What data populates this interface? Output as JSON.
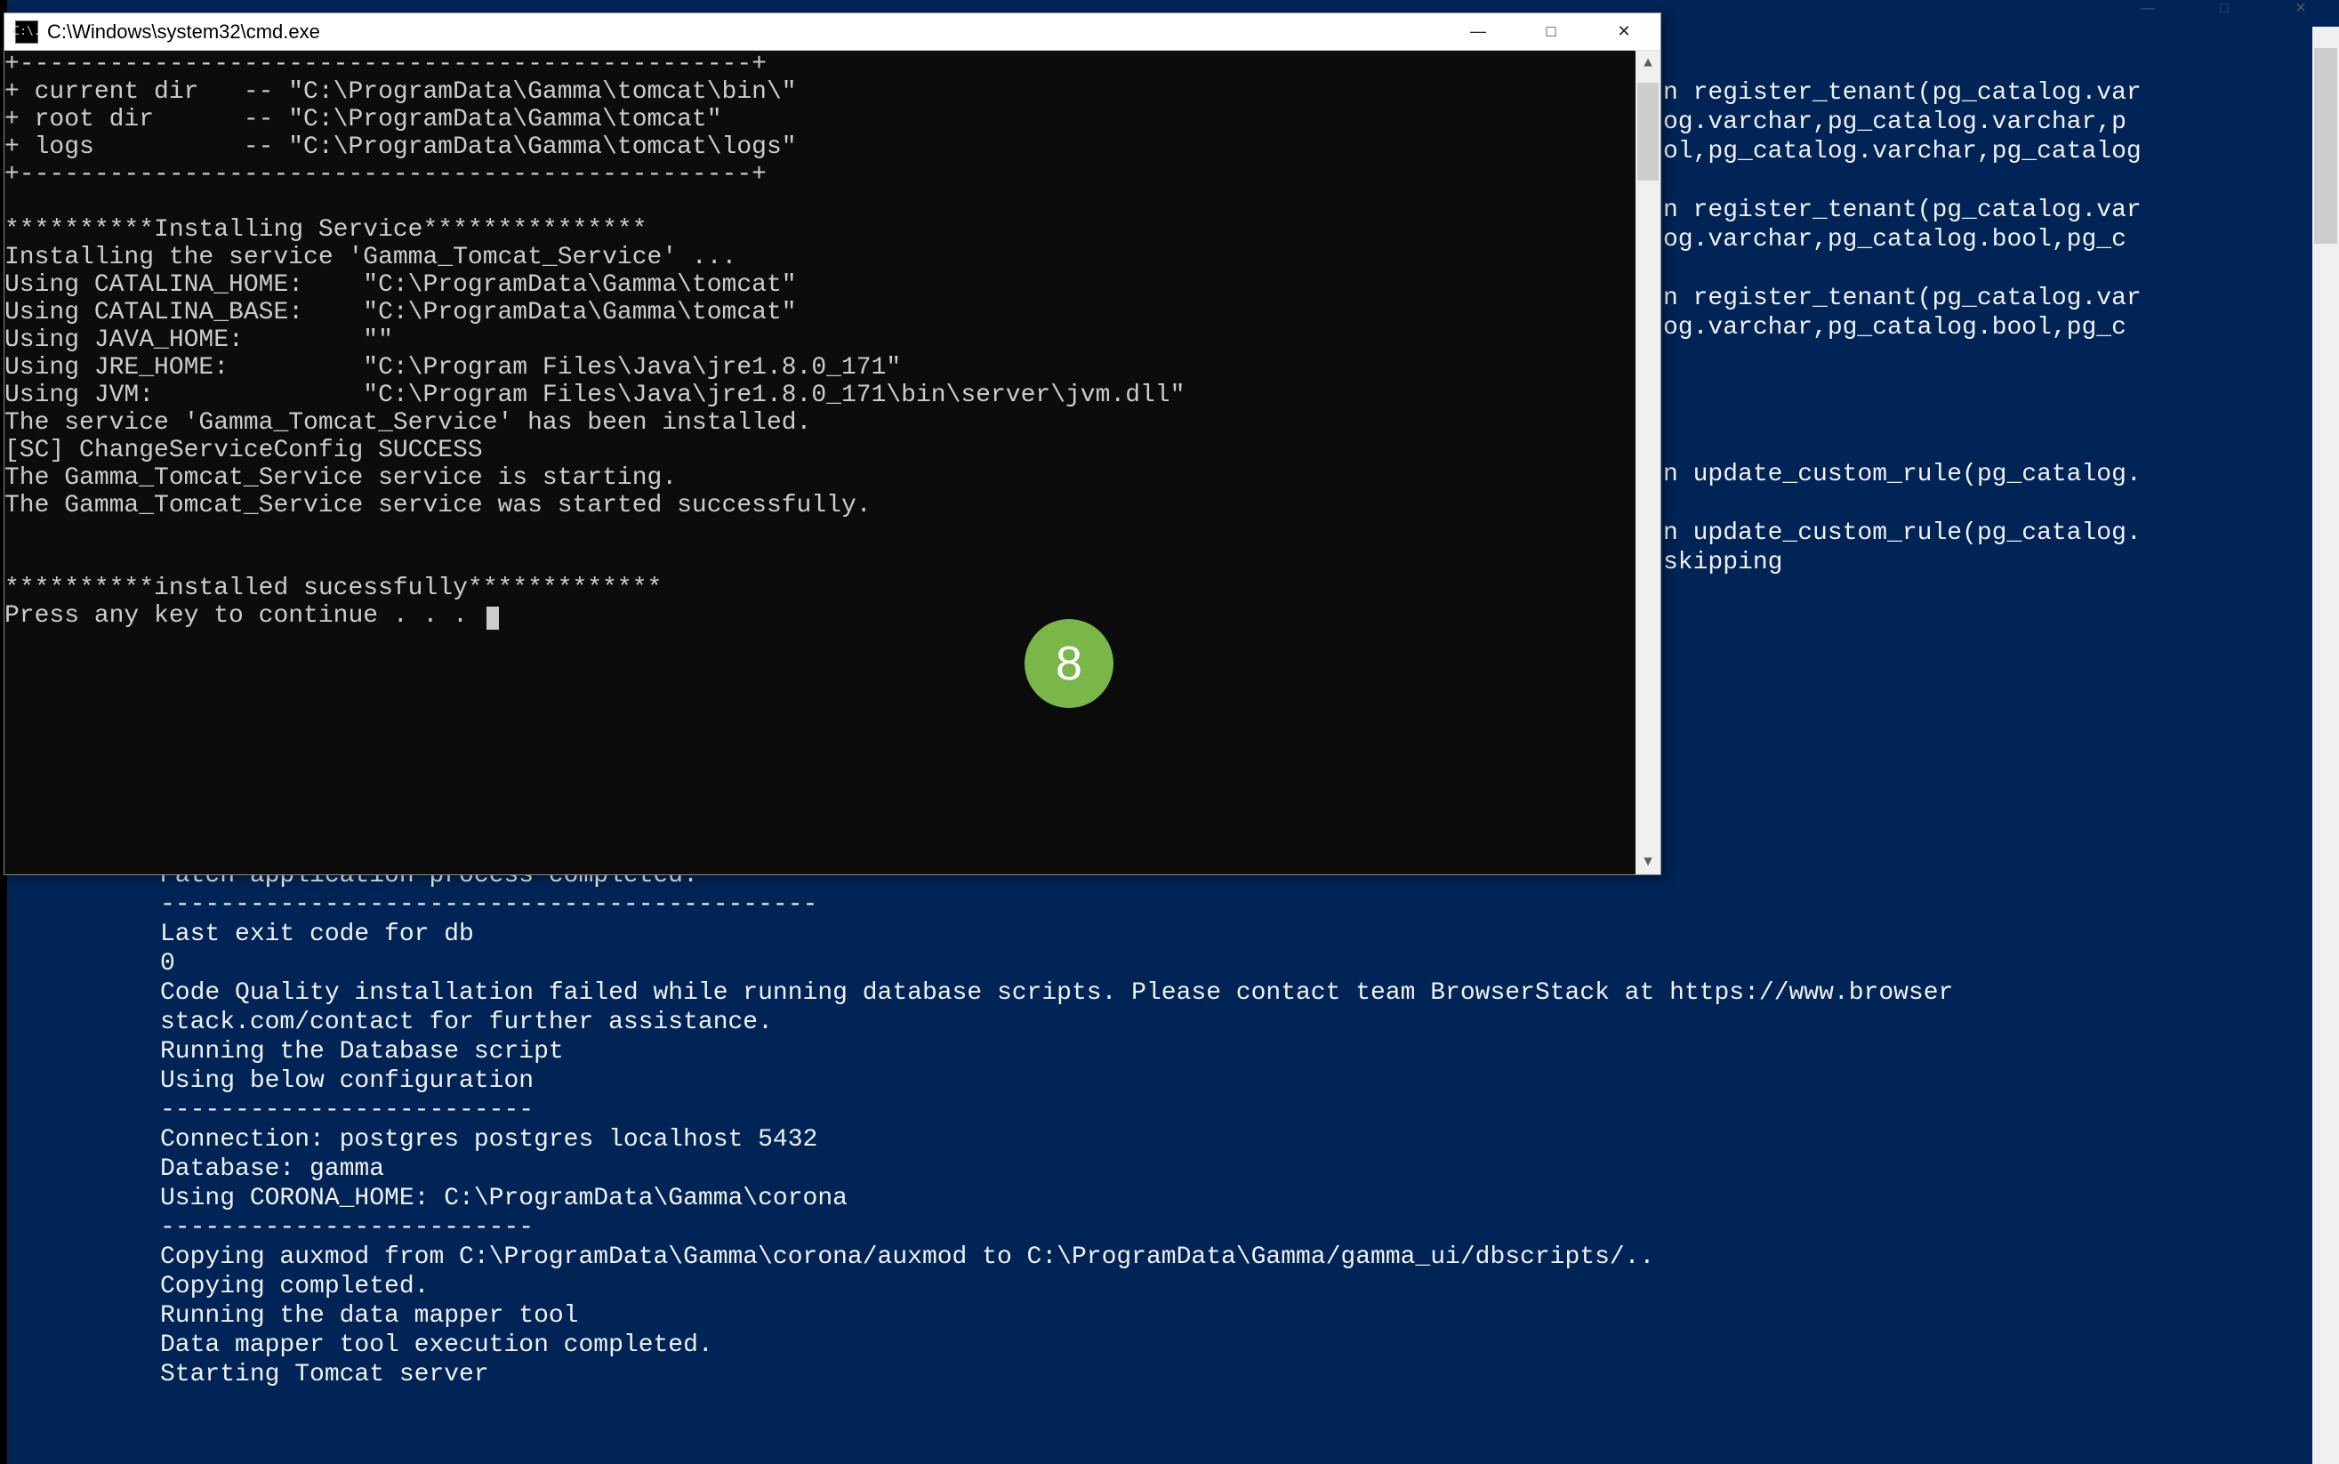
{
  "background_shell": {
    "right_lines": [
      "n register_tenant(pg_catalog.var",
      "og.varchar,pg_catalog.varchar,p",
      "ol,pg_catalog.varchar,pg_catalog",
      "",
      "n register_tenant(pg_catalog.var",
      "og.varchar,pg_catalog.bool,pg_c",
      "",
      "n register_tenant(pg_catalog.var",
      "og.varchar,pg_catalog.bool,pg_c",
      "",
      "",
      "",
      "",
      "n update_custom_rule(pg_catalog.",
      "",
      "n update_custom_rule(pg_catalog.",
      "skipping"
    ],
    "lines": [
      "Patch application process completed.",
      "--------------------------------------------",
      "Last exit code for db",
      "0",
      "Code Quality installation failed while running database scripts. Please contact team BrowserStack at https://www.browser",
      "stack.com/contact for further assistance.",
      "Running the Database script",
      "Using below configuration",
      "-------------------------",
      "Connection: postgres postgres localhost 5432",
      "Database: gamma",
      "Using CORONA_HOME: C:\\ProgramData\\Gamma\\corona",
      "-------------------------",
      "Copying auxmod from C:\\ProgramData\\Gamma\\corona/auxmod to C:\\ProgramData\\Gamma/gamma_ui/dbscripts/..",
      "Copying completed.",
      "Running the data mapper tool",
      "Data mapper tool execution completed.",
      "Starting Tomcat server"
    ]
  },
  "cmd_window": {
    "title": "C:\\Windows\\system32\\cmd.exe",
    "icon_text": "C:\\.",
    "lines": [
      "+-------------------------------------------------+",
      "+ current dir   -- \"C:\\ProgramData\\Gamma\\tomcat\\bin\\\"",
      "+ root dir      -- \"C:\\ProgramData\\Gamma\\tomcat\"",
      "+ logs          -- \"C:\\ProgramData\\Gamma\\tomcat\\logs\"",
      "+-------------------------------------------------+",
      "",
      "**********Installing Service***************",
      "Installing the service 'Gamma_Tomcat_Service' ...",
      "Using CATALINA_HOME:    \"C:\\ProgramData\\Gamma\\tomcat\"",
      "Using CATALINA_BASE:    \"C:\\ProgramData\\Gamma\\tomcat\"",
      "Using JAVA_HOME:        \"\"",
      "Using JRE_HOME:         \"C:\\Program Files\\Java\\jre1.8.0_171\"",
      "Using JVM:              \"C:\\Program Files\\Java\\jre1.8.0_171\\bin\\server\\jvm.dll\"",
      "The service 'Gamma_Tomcat_Service' has been installed.",
      "[SC] ChangeServiceConfig SUCCESS",
      "The Gamma_Tomcat_Service service is starting.",
      "The Gamma_Tomcat_Service service was started successfully.",
      "",
      "",
      "**********installed sucessfully*************",
      "Press any key to continue . . . "
    ],
    "btn_min": "—",
    "btn_max": "□",
    "btn_close": "✕"
  },
  "badge": {
    "number": "8"
  },
  "bg_window_controls": {
    "min": "—",
    "max": "□",
    "close": "✕"
  }
}
